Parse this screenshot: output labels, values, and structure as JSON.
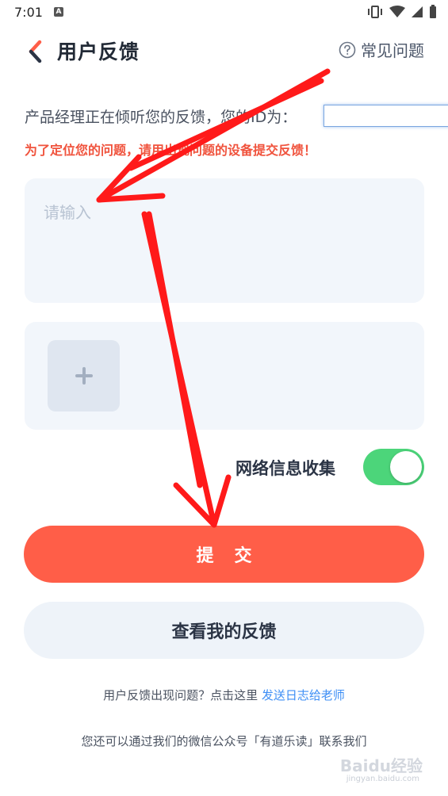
{
  "status_bar": {
    "time": "7:01",
    "notification_glyph": "A"
  },
  "header": {
    "title": "用户反馈",
    "faq_label": "常见问题"
  },
  "info": {
    "text": "产品经理正在倾听您的反馈，您的ID为：",
    "id_value": "",
    "warning": "为了定位您的问题，请用出现问题的设备提交反馈！"
  },
  "feedback": {
    "placeholder": "请输入",
    "value": ""
  },
  "network_toggle": {
    "label": "网络信息收集",
    "enabled": true
  },
  "buttons": {
    "submit": "提交",
    "view_feedback": "查看我的反馈"
  },
  "footer": {
    "prefix": "用户反馈出现问题？点击这里",
    "link": "发送日志给老师",
    "wechat": "您还可以通过我们的微信公众号「有道乐读」联系我们"
  },
  "watermark": {
    "main": "Baidu经验",
    "sub": "jingyan.baidu.com"
  },
  "colors": {
    "accent": "#ff5e48",
    "toggle_on": "#4cd57a",
    "link": "#3d8ef5",
    "warning": "#f0533d",
    "annotation": "#ff0000"
  }
}
